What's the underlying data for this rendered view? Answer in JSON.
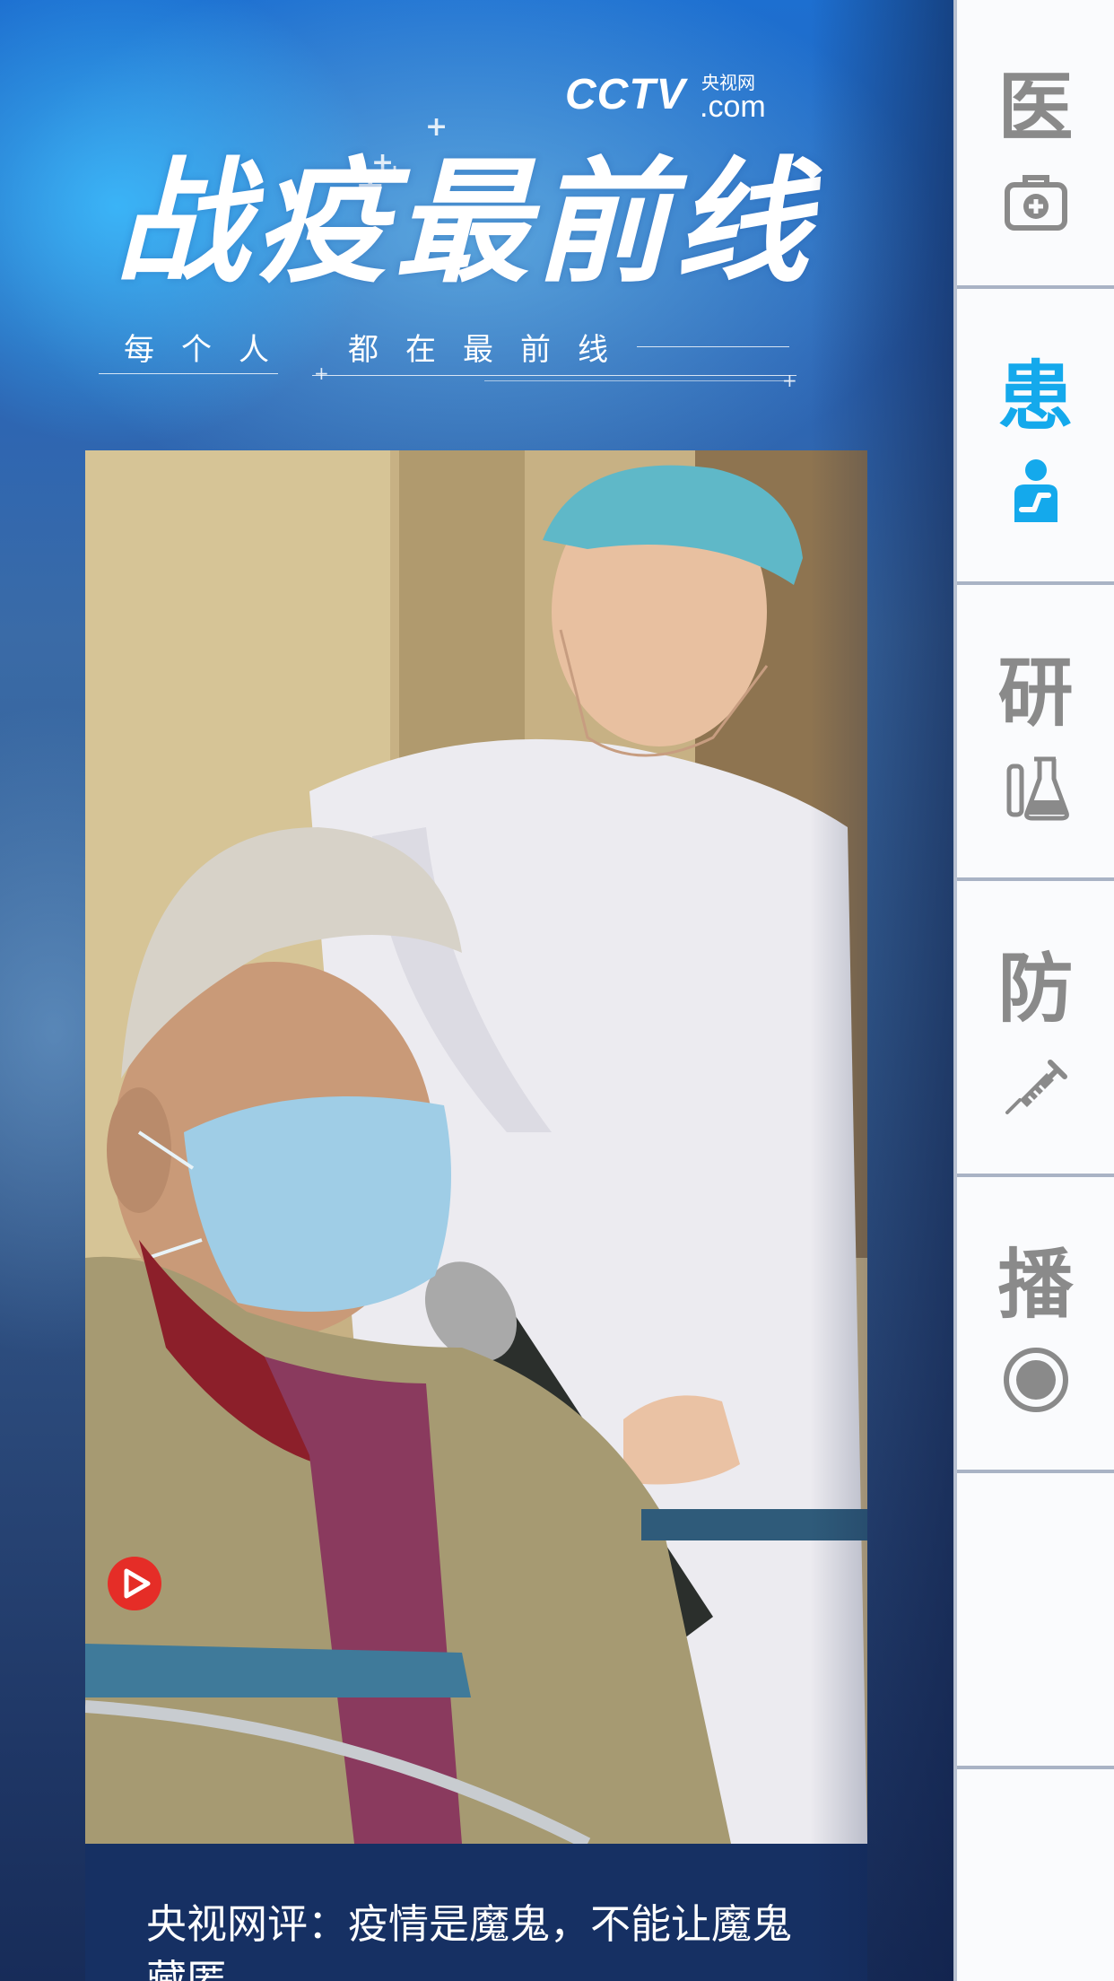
{
  "logo": {
    "brand": "CCTV",
    "cn_name": "央视网",
    "domain": ".com"
  },
  "banner": {
    "title": "战疫最前线",
    "subtitle_part1": "每个人",
    "subtitle_part2": "都在最前线"
  },
  "card": {
    "title": "央视网评：疫情是魔鬼，不能让魔鬼藏匿",
    "badge_icon": "play-icon",
    "accent_color": "#e52d27"
  },
  "side_nav": {
    "active_color": "#14a9ec",
    "inactive_color": "#8a8a8a",
    "items": [
      {
        "label": "医",
        "icon": "medical-kit-icon",
        "active": false
      },
      {
        "label": "患",
        "icon": "patient-icon",
        "active": true
      },
      {
        "label": "研",
        "icon": "flask-icon",
        "active": false
      },
      {
        "label": "防",
        "icon": "syringe-icon",
        "active": false
      },
      {
        "label": "播",
        "icon": "record-icon",
        "active": false
      },
      {
        "label": "",
        "icon": "",
        "active": false
      },
      {
        "label": "",
        "icon": "",
        "active": false
      }
    ]
  }
}
